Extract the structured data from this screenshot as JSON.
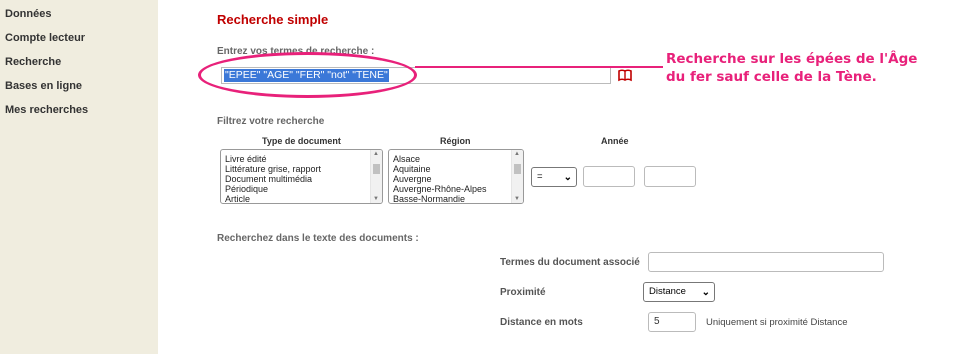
{
  "sidebar": {
    "items": [
      {
        "label": "Données"
      },
      {
        "label": "Compte lecteur"
      },
      {
        "label": "Recherche"
      },
      {
        "label": "Bases en ligne"
      },
      {
        "label": "Mes recherches"
      }
    ]
  },
  "main": {
    "title": "Recherche simple",
    "search_label": "Entrez vos termes de recherche :",
    "search_value": "\"EPEE\" \"AGE\" \"FER\" \"not\" \"TENE\"",
    "filter_label": "Filtrez votre recherche",
    "filters": {
      "type_header": "Type de document",
      "type_options": [
        "Livre édité",
        "Littérature grise, rapport",
        "Document multimédia",
        "Périodique",
        "Article"
      ],
      "region_header": "Région",
      "region_options": [
        "Alsace",
        "Aquitaine",
        "Auvergne",
        "Auvergne-Rhône-Alpes",
        "Basse-Normandie"
      ],
      "year_header": "Année",
      "year_operator": "=",
      "year_from": "",
      "year_to": ""
    },
    "fulltext_label": "Recherchez dans le texte des documents :",
    "assoc_label": "Termes du document associé",
    "assoc_value": "",
    "proximity_label": "Proximité",
    "proximity_value": "Distance",
    "distance_label": "Distance en mots",
    "distance_value": "5",
    "distance_hint": "Uniquement si proximité Distance"
  },
  "annotation": {
    "text": "Recherche sur les épées de l'Âge du fer sauf celle de la Tène.",
    "color": "#e8217a"
  },
  "colors": {
    "sidebar_bg": "#f0eddf",
    "title": "#c00000",
    "selection": "#3b78d8"
  }
}
